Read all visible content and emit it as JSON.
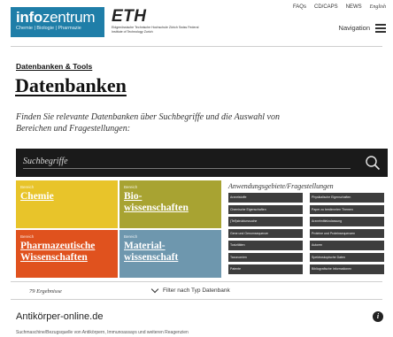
{
  "header": {
    "logo": {
      "main_bold": "info",
      "main_rest": "zentrum",
      "sub": "Chemie | Biologie | Pharmazie"
    },
    "eth": {
      "word": "ETH",
      "sub": "Eidgenössische Technische Hochschule Zürich Swiss Federal Institute of Technology Zurich"
    },
    "top_links": [
      "FAQs",
      "CD/CAPS",
      "NEWS",
      "English"
    ],
    "navigation_label": "Navigation"
  },
  "breadcrumb": "Datenbanken & Tools",
  "page_title": "Datenbanken",
  "intro": "Finden Sie relevante Datenbanken über Suchbegriffe und die Auswahl von Bereichen und Fragestellungen:",
  "search": {
    "placeholder": "Suchbegriffe",
    "icon": "search-icon"
  },
  "tiles": [
    {
      "kicker": "Bereich",
      "label": "Chemie",
      "color": "#e8c42a"
    },
    {
      "kicker": "Bereich",
      "label": "Bio-\nwissenschaften",
      "color": "#a8a332"
    },
    {
      "kicker": "Bereich",
      "label": "Pharmazeutische\nWissenschaften",
      "color": "#e0521e"
    },
    {
      "kicker": "Bereich",
      "label": "Material-\nwissenschaft",
      "color": "#6e97ae"
    }
  ],
  "questions": {
    "title": "Anwendungsgebiete/Fragestellungen",
    "items": [
      "Arzneistoffe",
      "Physikalische Eigenschaften",
      "Chemische Eigenschaften",
      "Paper zu bestimmten Themen",
      "(Teil)strukturssuche",
      "Arzneimittelzulassung",
      "Gene und Genomsequenze",
      "Proteine und Proteinsequenzen",
      "Toxizitäten",
      "Autoren",
      "Taxonomien",
      "Spektroskopische Daten",
      "Patente",
      "Bibliografische Informationen"
    ]
  },
  "results": {
    "count_text": "79 Ergebnisse",
    "filter_label": "Filter nach Typ Datenbank"
  },
  "entry": {
    "title": "Antikörper-online.de",
    "description": "Suchmaschine/Bezugsquelle von Antikörpern, Immunoassays und weiteren Reagenzien"
  }
}
